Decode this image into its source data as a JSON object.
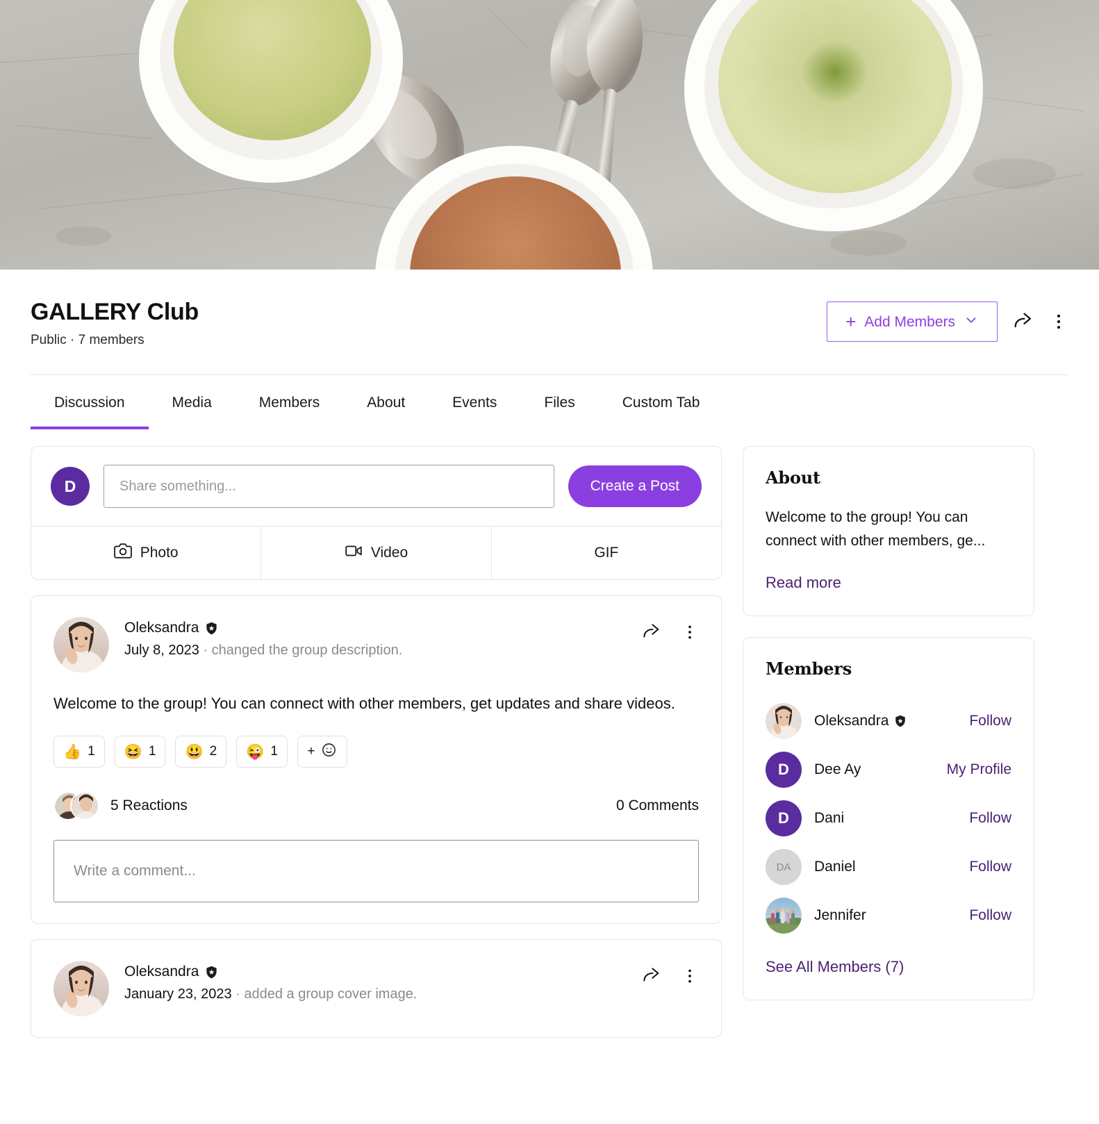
{
  "cover": {
    "alt": "group-cover-photo-tea-bowls-spoons"
  },
  "group": {
    "title": "GALLERY Club",
    "meta": "Public · 7 members",
    "add_members_label": "Add Members",
    "share_icon": "share-icon",
    "more_icon": "more-options-icon"
  },
  "tabs": [
    {
      "label": "Discussion",
      "active": true
    },
    {
      "label": "Media",
      "active": false
    },
    {
      "label": "Members",
      "active": false
    },
    {
      "label": "About",
      "active": false
    },
    {
      "label": "Events",
      "active": false
    },
    {
      "label": "Files",
      "active": false
    },
    {
      "label": "Custom Tab",
      "active": false
    }
  ],
  "composer": {
    "avatar_initial": "D",
    "placeholder": "Share something...",
    "value": "",
    "create_post_label": "Create a Post",
    "actions": [
      {
        "label": "Photo",
        "icon": "camera-icon"
      },
      {
        "label": "Video",
        "icon": "video-camera-icon"
      },
      {
        "label": "GIF",
        "icon": "gif-icon"
      }
    ]
  },
  "posts": [
    {
      "author": "Oleksandra",
      "verified": true,
      "date": "July 8, 2023",
      "action": "· changed the group description.",
      "body": "Welcome to the group! You can connect with other members, get updates and share videos.",
      "reactions": [
        {
          "emoji": "👍",
          "count": "1",
          "name": "thumbs-up-reaction"
        },
        {
          "emoji": "😆",
          "count": "1",
          "name": "laughing-reaction"
        },
        {
          "emoji": "😃",
          "count": "2",
          "name": "grinning-reaction"
        },
        {
          "emoji": "😜",
          "count": "1",
          "name": "winking-tongue-reaction"
        }
      ],
      "add_reaction_label": "+",
      "reactions_summary": "5 Reactions",
      "comments_summary": "0 Comments",
      "comment_placeholder": "Write a comment...",
      "comment_value": ""
    },
    {
      "author": "Oleksandra",
      "verified": true,
      "date": "January 23, 2023",
      "action": "· added a group cover image."
    }
  ],
  "about": {
    "title": "About",
    "text": "Welcome to the group! You can connect with other members, ge...",
    "read_more_label": "Read more"
  },
  "members_card": {
    "title": "Members",
    "items": [
      {
        "name": "Oleksandra",
        "verified": true,
        "action": "Follow",
        "avatar_type": "photo-woman",
        "initials": ""
      },
      {
        "name": "Dee Ay",
        "verified": false,
        "action": "My Profile",
        "avatar_type": "initials-purple",
        "initials": "D"
      },
      {
        "name": "Dani",
        "verified": false,
        "action": "Follow",
        "avatar_type": "initials-purple",
        "initials": "D"
      },
      {
        "name": "Daniel",
        "verified": false,
        "action": "Follow",
        "avatar_type": "initials-gray",
        "initials": "DA"
      },
      {
        "name": "Jennifer",
        "verified": false,
        "action": "Follow",
        "avatar_type": "photo-group",
        "initials": ""
      }
    ],
    "see_all_label": "See All Members (7)"
  },
  "colors": {
    "accent_purple": "#8b3fe0",
    "avatar_purple": "#5a2ca0",
    "link_purple": "#4b2272",
    "text_primary": "#111111",
    "text_muted": "#8a8a8a",
    "border": "#e6e6e6"
  }
}
